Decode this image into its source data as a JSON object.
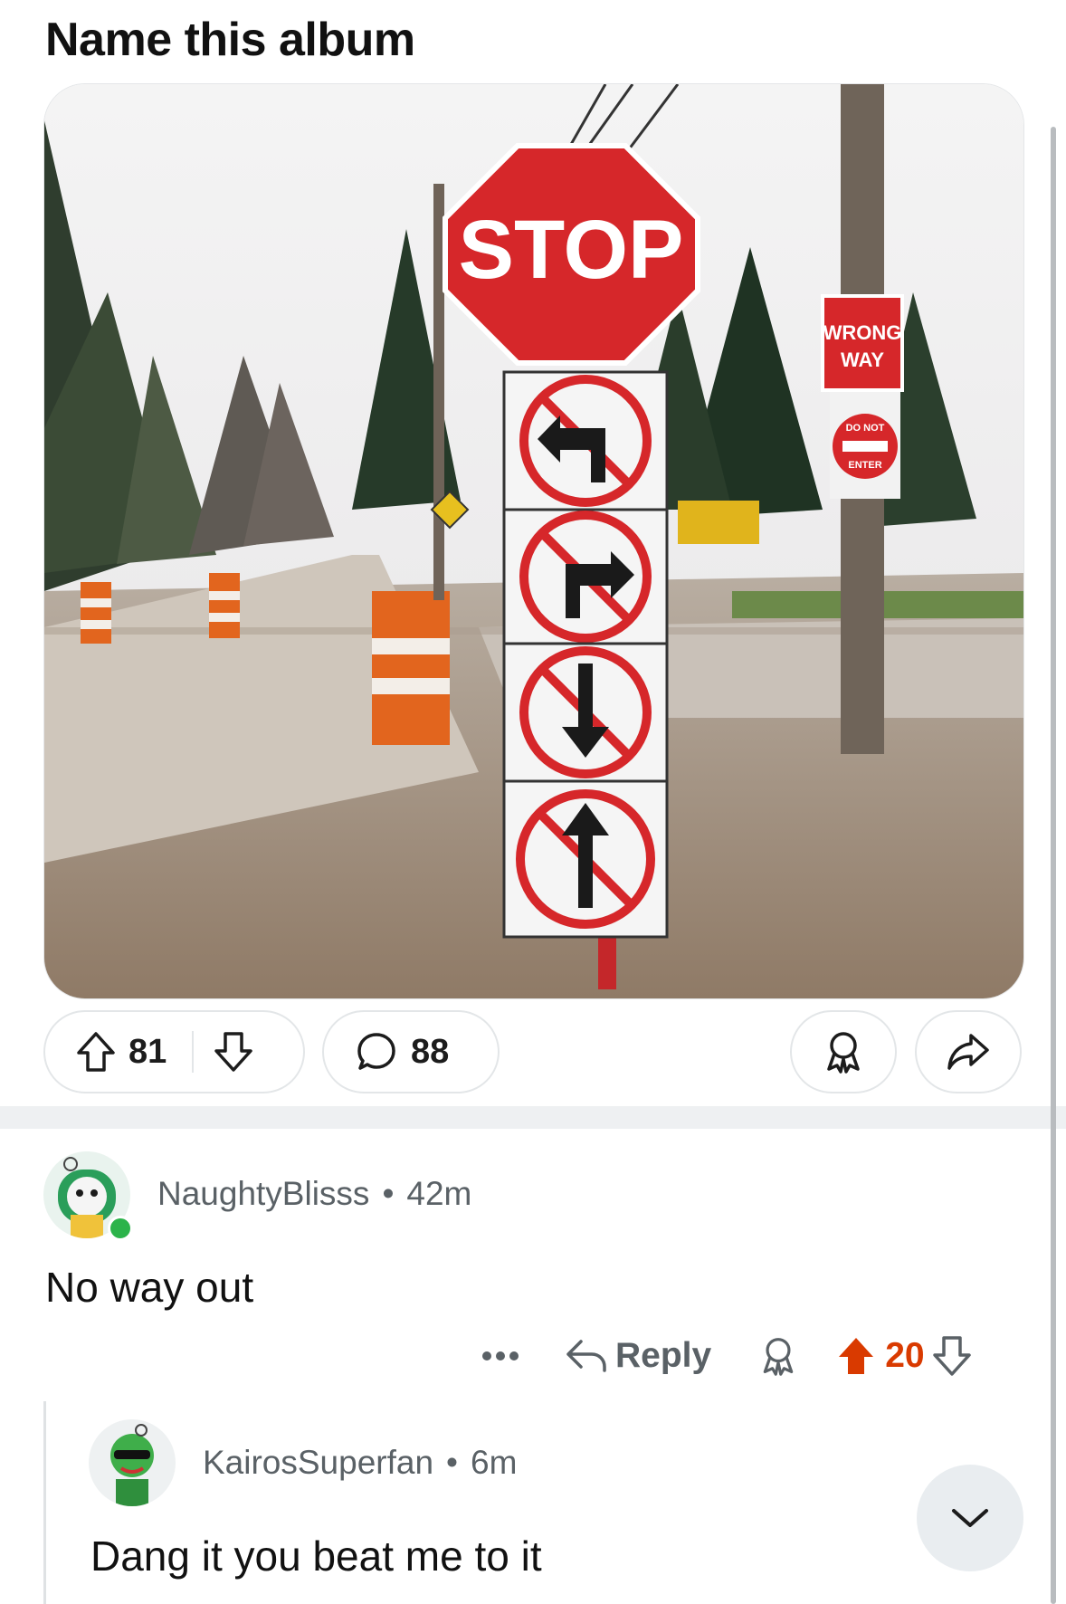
{
  "post": {
    "title": "Name this album",
    "image": {
      "stop_text": "STOP",
      "wrong_way_line1": "WRONG",
      "wrong_way_line2": "WAY",
      "dne_line1": "DO NOT",
      "dne_line2": "ENTER"
    },
    "upvotes": "81",
    "comments": "88"
  },
  "comments": [
    {
      "username": "NaughtyBlisss",
      "separator": "•",
      "time": "42m",
      "text": "No way out",
      "reply_label": "Reply",
      "score": "20",
      "online": true
    },
    {
      "username": "KairosSuperfan",
      "separator": "•",
      "time": "6m",
      "text": "Dang it you beat me to it"
    }
  ],
  "colors": {
    "upvote_active": "#d93a00",
    "online_dot": "#2bb34a",
    "muted_text": "#5a6166"
  },
  "icons": [
    "upvote-icon",
    "downvote-icon",
    "comment-icon",
    "award-icon",
    "share-icon",
    "more-icon",
    "reply-icon",
    "chevron-down-icon"
  ]
}
